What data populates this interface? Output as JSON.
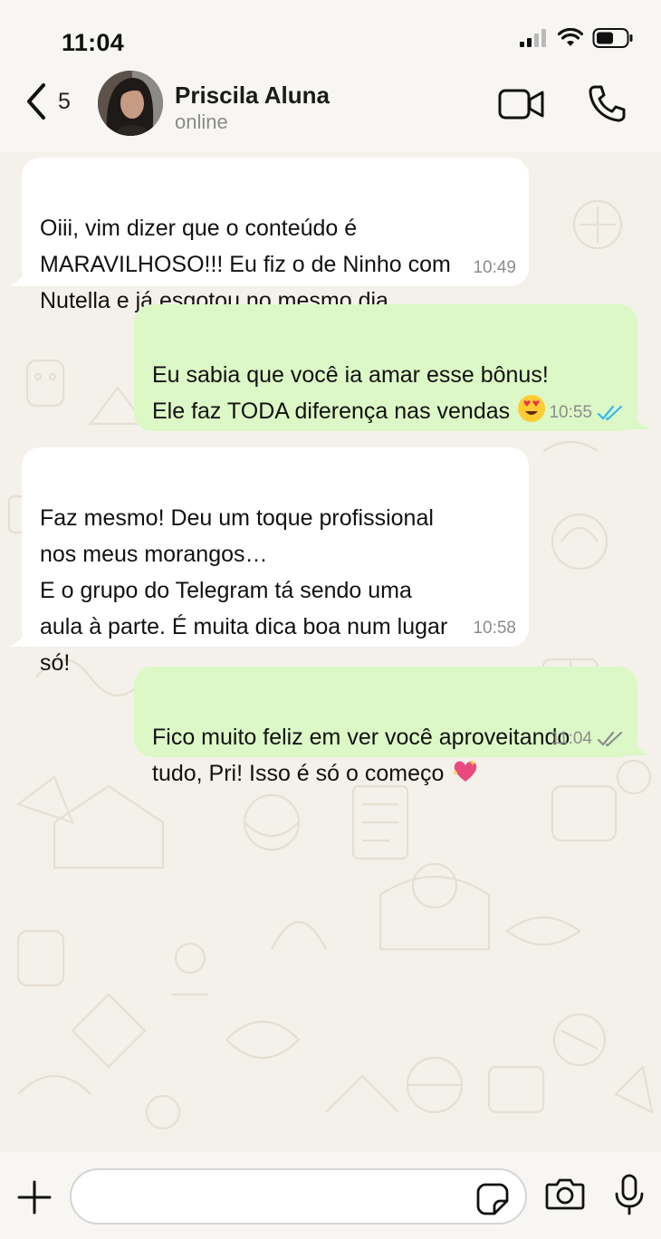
{
  "status_bar": {
    "time": "11:04"
  },
  "header": {
    "back_count": "5",
    "contact_name": "Priscila Aluna",
    "contact_status": "online"
  },
  "messages": [
    {
      "direction": "incoming",
      "text": "Oiii, vim dizer que o conteúdo é\nMARAVILHOSO!!! Eu fiz o de Ninho com\nNutella e já esgotou no mesmo dia",
      "time": "10:49"
    },
    {
      "direction": "outgoing",
      "text": "Eu sabia que você ia amar esse bônus!\nEle faz TODA diferença nas vendas",
      "emoji": "heart-eyes-emoji",
      "time": "10:55",
      "read": true,
      "tick_color": "#34b7f1"
    },
    {
      "direction": "incoming",
      "text": "Faz mesmo! Deu um toque profissional\nnos meus morangos…\nE o grupo do Telegram tá sendo uma\naula à parte. É muita dica boa num lugar\nsó!",
      "time": "10:58"
    },
    {
      "direction": "outgoing",
      "text": "Fico muito feliz em ver você aproveitando\ntudo, Pri! Isso é só o começo",
      "emoji": "sparkling-heart-emoji",
      "time": "11:04",
      "read": false,
      "tick_color": "#8c8c8c"
    }
  ],
  "composer": {
    "placeholder": ""
  },
  "colors": {
    "incoming_bubble": "#ffffff",
    "outgoing_bubble": "#dcf8c6",
    "read_tick": "#34b7f1"
  }
}
